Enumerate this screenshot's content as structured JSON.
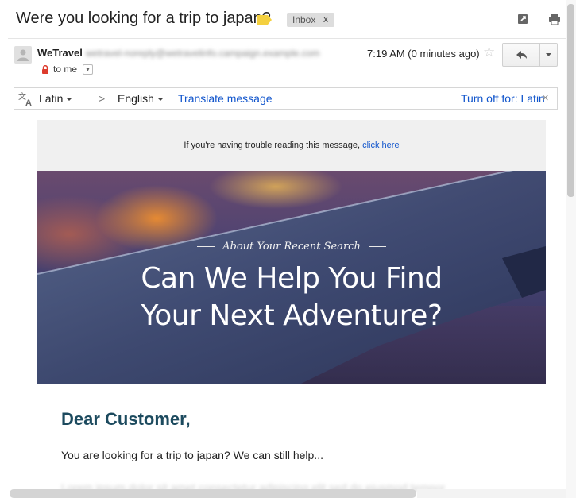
{
  "subject": "Were you looking for a trip to japan?",
  "labels": {
    "inbox": "Inbox",
    "remove": "x"
  },
  "sender": {
    "name": "WeTravel",
    "email": "wetravel-noreply@wetravelinfo.campaign.example.com",
    "to_label": "to me",
    "timestamp": "7:19 AM (0 minutes ago)"
  },
  "icons": {
    "importance": "importance-marker-icon",
    "popout": "open-new-window-icon",
    "print": "print-icon",
    "reply": "reply-icon",
    "more": "more-options-icon"
  },
  "translate_bar": {
    "from_lang": "Latin",
    "arrow": ">",
    "to_lang": "English",
    "translate_link": "Translate message",
    "turn_off": "Turn off for: Latin",
    "close": "×"
  },
  "email_body": {
    "trouble_text": "If you're having trouble reading this message,",
    "trouble_link": "click here",
    "hero_subtitle": "About Your Recent Search",
    "hero_title_line1": "Can We Help You Find",
    "hero_title_line2": "Your Next Adventure?",
    "greeting": "Dear Customer,",
    "paragraph1": "You are looking for a trip to japan? We can still help...",
    "paragraph2": "Lorem ipsum dolor sit amet consectetur adipiscing elit sed do eiusmod tempor"
  },
  "colors": {
    "link": "#1155cc",
    "importance": "#f4d03f",
    "greeting": "#1c4a5e",
    "lock": "#dd3b2d"
  }
}
